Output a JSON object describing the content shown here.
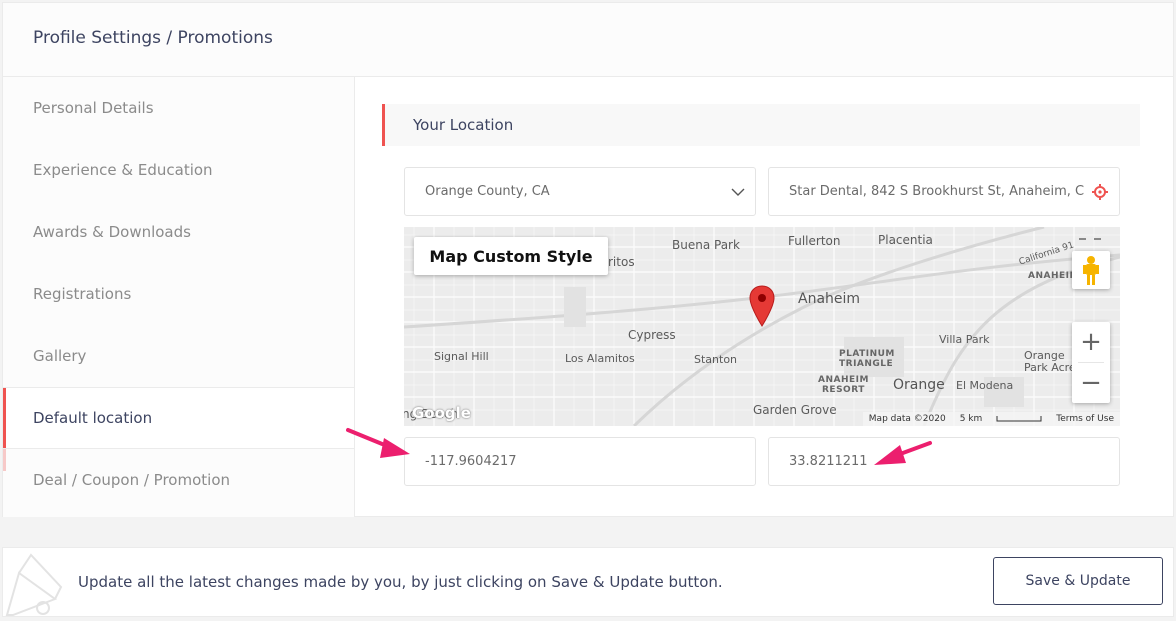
{
  "header": {
    "title": "Profile Settings / Promotions"
  },
  "sidebar": {
    "items": [
      {
        "label": "Personal Details"
      },
      {
        "label": "Experience & Education"
      },
      {
        "label": "Awards & Downloads"
      },
      {
        "label": "Registrations"
      },
      {
        "label": "Gallery"
      },
      {
        "label": "Default location",
        "active": true
      },
      {
        "label": "Deal / Coupon / Promotion"
      }
    ]
  },
  "location": {
    "section_title": "Your Location",
    "city_value": "Orange County, CA",
    "address_value": "Star Dental, 842 S Brookhurst St, Anaheim, C",
    "longitude": "-117.9604217",
    "latitude": "33.8211211"
  },
  "map": {
    "style_button": "Map Custom Style",
    "labels": {
      "buena_park": "Buena Park",
      "fullerton": "Fullerton",
      "placentia": "Placentia",
      "california91": "California 91",
      "anaheim_hills": "ANAHEIM",
      "writos": "ritos",
      "anaheim": "Anaheim",
      "cypress": "Cypress",
      "villa_park": "Villa Park",
      "signal_hill": "Signal Hill",
      "los_alamitos": "Los Alamitos",
      "stanton": "Stanton",
      "platinum1": "PLATINUM",
      "platinum2": "TRIANGLE",
      "orange_park1": "Orange",
      "orange_park2": "Park Acres",
      "anaheim_resort1": "ANAHEIM",
      "anaheim_resort2": "RESORT",
      "orange": "Orange",
      "el_modena": "El Modena",
      "long_beach": "ng Beach",
      "garden_grove": "Garden Grove"
    },
    "google": "Google",
    "attribution": "Map data ©2020",
    "scale": "5 km",
    "terms": "Terms of Use",
    "zoom_in": "+",
    "zoom_out": "−"
  },
  "footer": {
    "message": "Update all the latest changes made by you, by just clicking on Save & Update button.",
    "save_label": "Save & Update"
  },
  "colors": {
    "accent": "#ef5350",
    "text": "#3d4461",
    "arrow": "#ec1f6e"
  }
}
